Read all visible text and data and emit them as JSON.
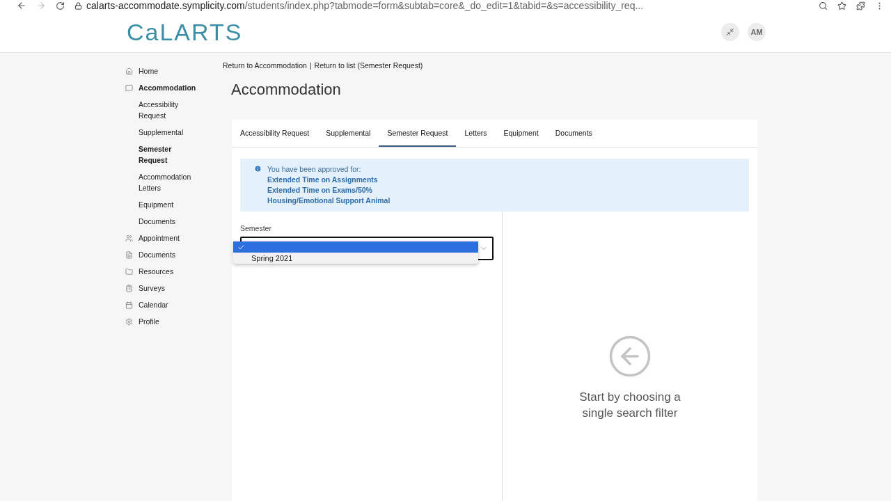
{
  "browser": {
    "url_host": "calarts-accommodate.symplicity.com",
    "url_path": "/students/index.php?tabmode=form&subtab=core&_do_edit=1&tabid=&s=accessibility_req..."
  },
  "header": {
    "logo": "CaLARTS",
    "avatar": "AM"
  },
  "sidebar": {
    "items": [
      {
        "label": "Home",
        "selected": false
      },
      {
        "label": "Accommodation",
        "selected": true,
        "children": [
          {
            "label": "Accessibility Request",
            "selected": false
          },
          {
            "label": "Supplemental",
            "selected": false
          },
          {
            "label": "Semester Request",
            "selected": true
          },
          {
            "label": "Accommodation Letters",
            "selected": false
          },
          {
            "label": "Equipment",
            "selected": false
          },
          {
            "label": "Documents",
            "selected": false
          }
        ]
      },
      {
        "label": "Appointment",
        "selected": false
      },
      {
        "label": "Documents",
        "selected": false
      },
      {
        "label": "Resources",
        "selected": false
      },
      {
        "label": "Surveys",
        "selected": false
      },
      {
        "label": "Calendar",
        "selected": false
      },
      {
        "label": "Profile",
        "selected": false
      }
    ]
  },
  "breadcrumbs": {
    "links": [
      "Return to Accommodation",
      "Return to list (Semester Request)"
    ],
    "separator": "|"
  },
  "title": "Accommodation",
  "tabs": [
    {
      "label": "Accessibility Request",
      "selected": false
    },
    {
      "label": "Supplemental",
      "selected": false
    },
    {
      "label": "Semester Request",
      "selected": true
    },
    {
      "label": "Letters",
      "selected": false
    },
    {
      "label": "Equipment",
      "selected": false
    },
    {
      "label": "Documents",
      "selected": false
    }
  ],
  "notice": {
    "intro": "You have been approved for:",
    "items": [
      "Extended Time on Assignments",
      "Extended Time on Exams/50%",
      "Housing/Emotional Support Animal"
    ]
  },
  "semester": {
    "label": "Semester",
    "options": [
      {
        "selected": true
      },
      {
        "label": "Spring 2021",
        "selected": false
      }
    ]
  },
  "empty_state": {
    "message": "Start by choosing a single search filter"
  }
}
